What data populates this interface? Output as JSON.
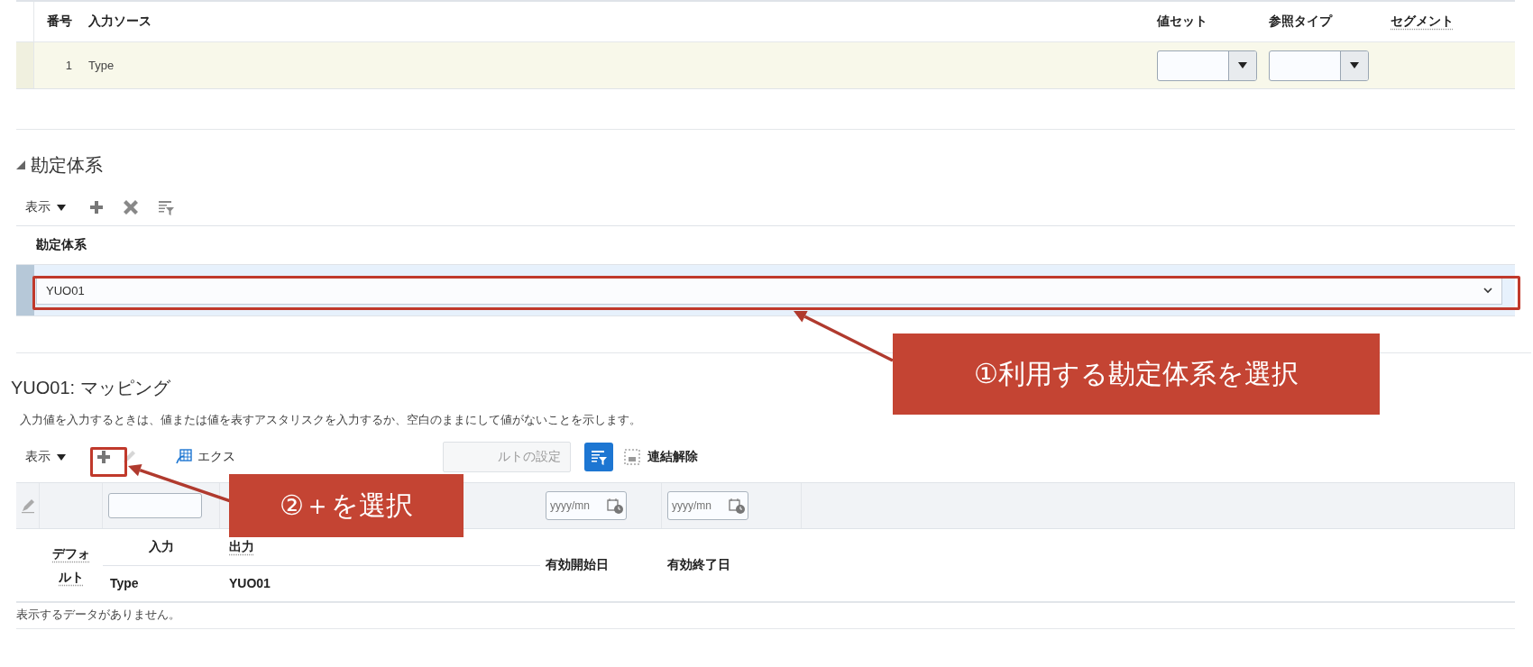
{
  "source_table": {
    "columns": [
      "番号",
      "入力ソース",
      "値セット",
      "参照タイプ",
      "セグメント"
    ],
    "rows": [
      {
        "number": "1",
        "input_source": "Type"
      }
    ]
  },
  "chart_of_accounts": {
    "title": "勘定体系",
    "expanded": true,
    "view_menu": "表示",
    "column": "勘定体系",
    "rows": [
      {
        "value": "YUO01",
        "selected": true
      }
    ]
  },
  "mapping": {
    "title": "YUO01: マッピング",
    "instruction": "入力値を入力するときは、値または値を表すアスタリスクを入力するか、空白のままにして値がないことを示します。",
    "view_menu": "表示",
    "export": "エクス",
    "default_button": "ルトの設定",
    "unlink": "連結解除",
    "date_placeholders": [
      "yyyy/mn",
      "yyyy/mn"
    ],
    "columns": {
      "default": "デフォルト",
      "input": "入力",
      "output": "出力",
      "input_sub": "Type",
      "output_sub": "YUO01",
      "start_date": "有効開始日",
      "end_date": "有効終了日"
    },
    "empty_message": "表示するデータがありません。"
  },
  "annotations": [
    {
      "text": "①利用する勘定体系を選択"
    },
    {
      "text": "②＋を選択"
    }
  ]
}
